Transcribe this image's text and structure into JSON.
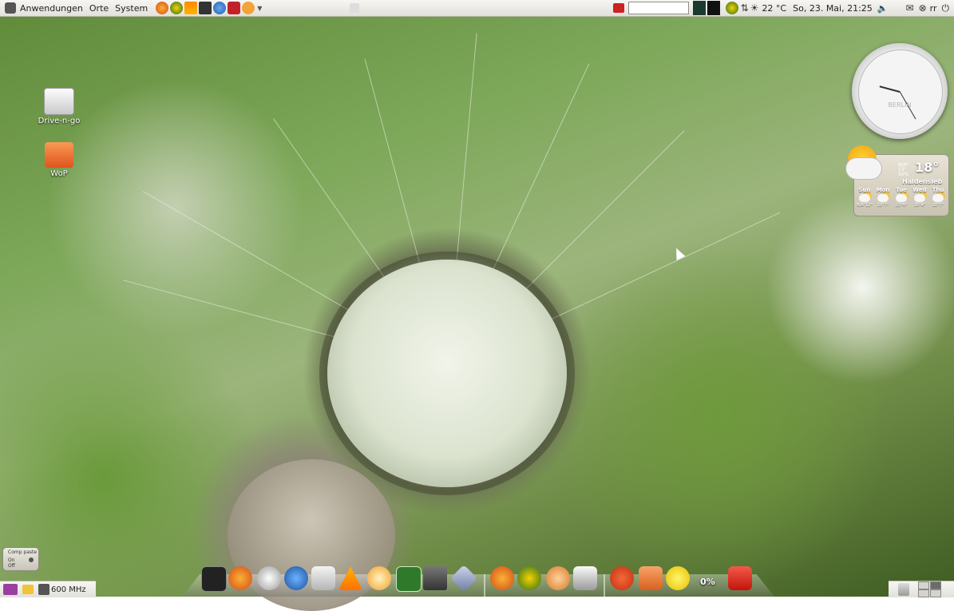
{
  "top_panel": {
    "menus": [
      "Anwendungen",
      "Orte",
      "System"
    ],
    "launchers": [
      "firefox-icon",
      "globe-icon",
      "vlc-icon",
      "system-monitor-icon",
      "help-icon",
      "screenshot-icon",
      "synaptic-icon"
    ],
    "search_value": "",
    "temperature": "22 °C",
    "datetime": "So, 23. Mai, 21:25",
    "user": "rr"
  },
  "desktop_icons": [
    {
      "label": "Drive-n-go",
      "icon": "usb-drive-icon"
    },
    {
      "label": "WoP",
      "icon": "folder-icon"
    }
  ],
  "clock_widget": {
    "city": "BERLIN",
    "time": "21:25"
  },
  "weather_widget": {
    "temperature": "18°",
    "now_line1": "N/A°",
    "now_line2": "13°",
    "now_line3": "50%",
    "location": "Haldensleb",
    "forecast": [
      {
        "day": "Sun",
        "temps": "N/A°13°"
      },
      {
        "day": "Mon",
        "temps": "19°7°"
      },
      {
        "day": "Tue",
        "temps": "23°4°"
      },
      {
        "day": "Wed",
        "temps": "16°4°"
      },
      {
        "day": "Thu",
        "temps": "18°7°"
      }
    ]
  },
  "compiz_widget": {
    "title": "Comp paste",
    "on": "On",
    "off": "Off"
  },
  "dock": {
    "items": [
      "terminal-icon",
      "firefox-icon",
      "info-icon",
      "thunderbird-icon",
      "printer-icon",
      "vlc-icon",
      "burner-icon",
      "calculator-icon",
      "tools-icon",
      "system-icon",
      "firefox-icon",
      "network-icon",
      "hand-icon",
      "screen-icon",
      "ubuntu-icon",
      "downloads-icon",
      "notification-icon",
      "power-icon"
    ],
    "cpu_load": "0%"
  },
  "bottom_panel": {
    "cpu_freq": "600 MHz",
    "workspaces": 4,
    "active_workspace": 2
  }
}
